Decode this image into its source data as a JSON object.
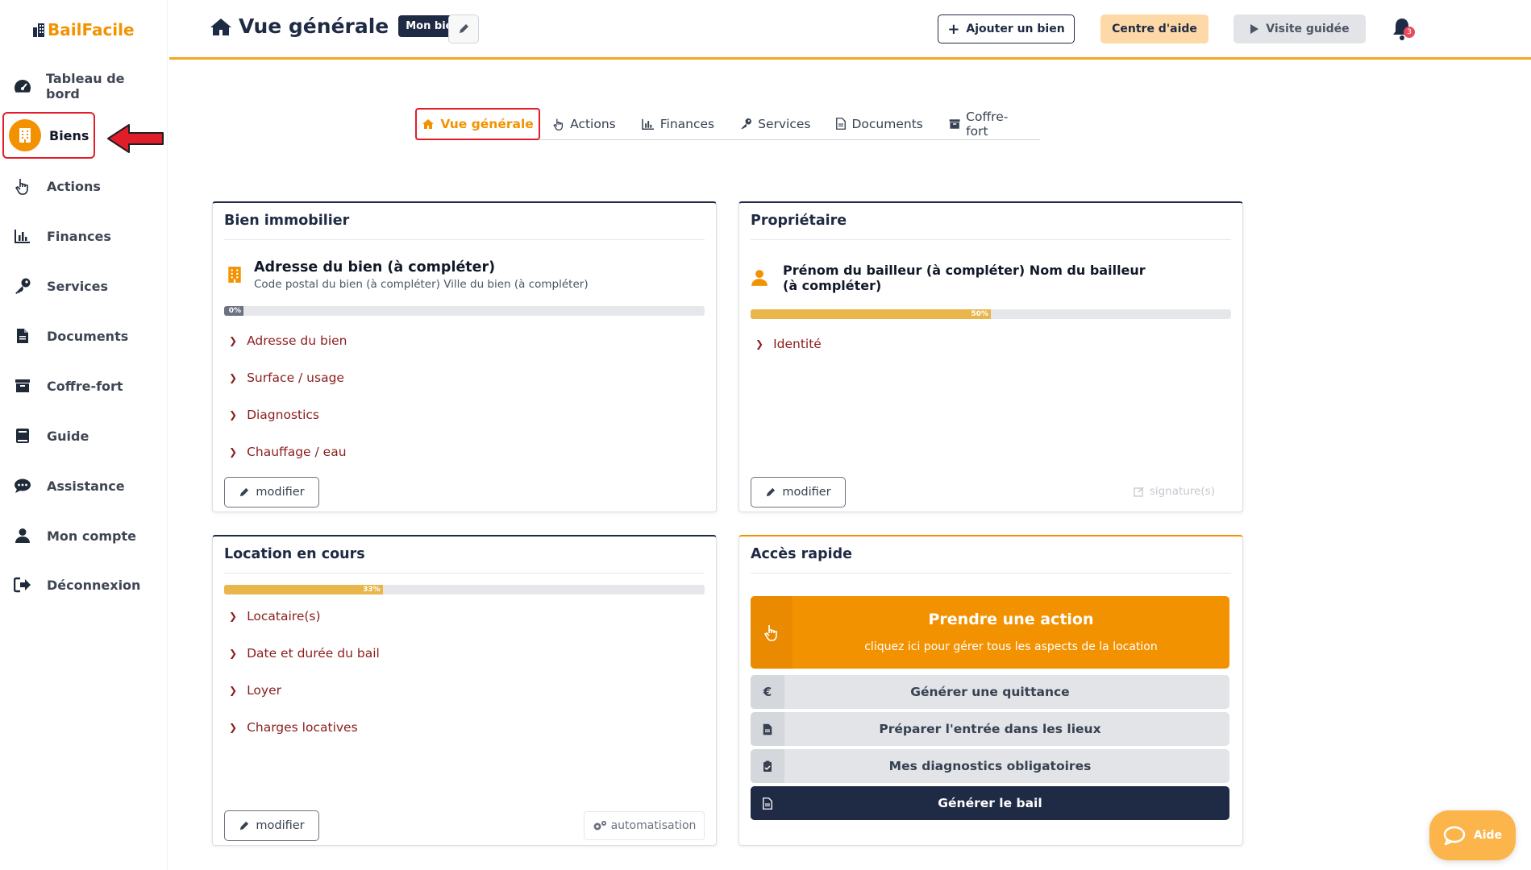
{
  "logo": {
    "text": "BailFacile"
  },
  "sidebar": {
    "items": [
      {
        "label": "Tableau de bord",
        "icon": "dashboard-gauge-icon"
      },
      {
        "label": "Biens",
        "icon": "building-icon",
        "active": true
      },
      {
        "label": "Actions",
        "icon": "hand-pointer-icon"
      },
      {
        "label": "Finances",
        "icon": "bar-chart-icon"
      },
      {
        "label": "Services",
        "icon": "key-icon"
      },
      {
        "label": "Documents",
        "icon": "document-icon"
      },
      {
        "label": "Coffre-fort",
        "icon": "archive-box-icon"
      },
      {
        "label": "Guide",
        "icon": "book-icon"
      },
      {
        "label": "Assistance",
        "icon": "chat-bubble-icon"
      },
      {
        "label": "Mon compte",
        "icon": "user-icon"
      },
      {
        "label": "Déconnexion",
        "icon": "logout-icon"
      }
    ]
  },
  "header": {
    "title": "Vue générale",
    "badge": "Mon bien",
    "add_property": "Ajouter un bien",
    "help_center": "Centre d'aide",
    "guided_tour": "Visite guidée",
    "notifications_count": "3"
  },
  "tabs": [
    {
      "label": "Vue générale",
      "icon": "home-icon",
      "active": true
    },
    {
      "label": "Actions",
      "icon": "hand-pointer-icon"
    },
    {
      "label": "Finances",
      "icon": "bar-chart-icon"
    },
    {
      "label": "Services",
      "icon": "key-icon"
    },
    {
      "label": "Documents",
      "icon": "document-icon"
    },
    {
      "label": "Coffre-fort",
      "icon": "archive-box-icon"
    }
  ],
  "property_card": {
    "title": "Bien immobilier",
    "address": "Adresse du bien (à compléter)",
    "city": "Code postal du bien (à compléter) Ville du bien (à compléter)",
    "progress": 0,
    "progress_label": "0%",
    "links": [
      "Adresse du bien",
      "Surface / usage",
      "Diagnostics",
      "Chauffage / eau"
    ],
    "edit_label": "modifier"
  },
  "owner_card": {
    "title": "Propriétaire",
    "name": "Prénom du bailleur (à compléter) Nom du bailleur (à compléter)",
    "progress": 50,
    "progress_label": "50%",
    "links": [
      "Identité"
    ],
    "edit_label": "modifier",
    "signature_label": "signature(s)"
  },
  "lease_card": {
    "title": "Location en cours",
    "progress": 33,
    "progress_label": "33%",
    "links": [
      "Locataire(s)",
      "Date et durée du bail",
      "Loyer",
      "Charges locatives"
    ],
    "edit_label": "modifier",
    "automation_label": "automatisation"
  },
  "quick_access": {
    "title": "Accès rapide",
    "main_title": "Prendre une action",
    "main_sub": "cliquez ici pour gérer tous les aspects de la location",
    "rows": [
      {
        "label": "Générer une quittance",
        "icon": "euro-icon"
      },
      {
        "label": "Préparer l'entrée dans les lieux",
        "icon": "document-icon"
      },
      {
        "label": "Mes diagnostics obligatoires",
        "icon": "clipboard-check-icon"
      },
      {
        "label": "Générer le bail",
        "icon": "document-icon"
      }
    ]
  },
  "help_fab": {
    "label": "Aide"
  },
  "colors": {
    "accent": "#f39200",
    "navy": "#1f2a44",
    "link": "#8b1c1c",
    "highlight": "#e11d2a"
  }
}
